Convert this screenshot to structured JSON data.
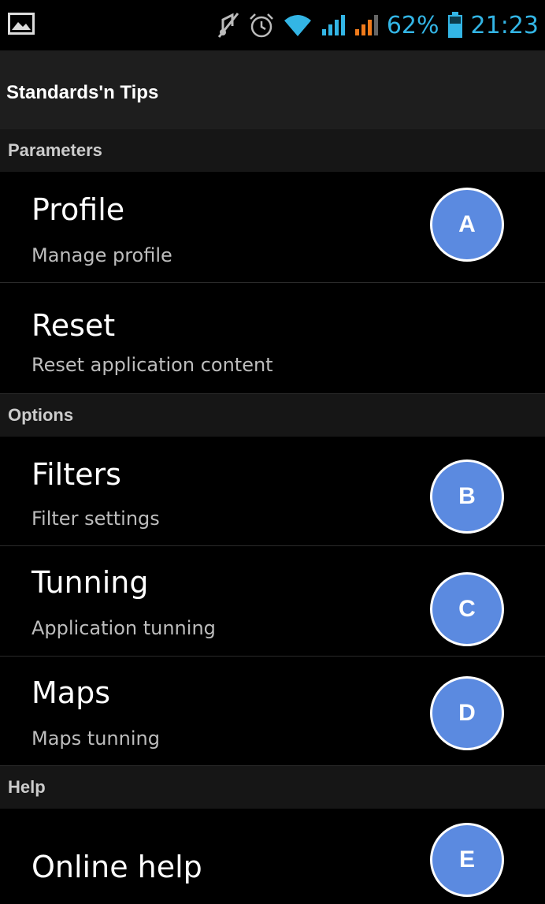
{
  "status_bar": {
    "battery_percent": "62%",
    "time": "21:23",
    "accent_color": "#33b5e5",
    "icons": [
      "image-icon",
      "mute-icon",
      "alarm-icon",
      "wifi-icon",
      "signal-icon",
      "signal-icon",
      "battery-icon"
    ]
  },
  "app": {
    "title": "Standards'n Tips"
  },
  "sections": {
    "parameters": {
      "label": "Parameters"
    },
    "options": {
      "label": "Options"
    },
    "help": {
      "label": "Help"
    }
  },
  "items": {
    "profile": {
      "title": "Profile",
      "subtitle": "Manage profile",
      "badge": "A"
    },
    "reset": {
      "title": "Reset",
      "subtitle": "Reset application content"
    },
    "filters": {
      "title": "Filters",
      "subtitle": "Filter settings",
      "badge": "B"
    },
    "tunning": {
      "title": "Tunning",
      "subtitle": "Application tunning",
      "badge": "C"
    },
    "maps": {
      "title": "Maps",
      "subtitle": "Maps tunning",
      "badge": "D"
    },
    "online_help": {
      "title": "Online help",
      "badge": "E"
    }
  }
}
